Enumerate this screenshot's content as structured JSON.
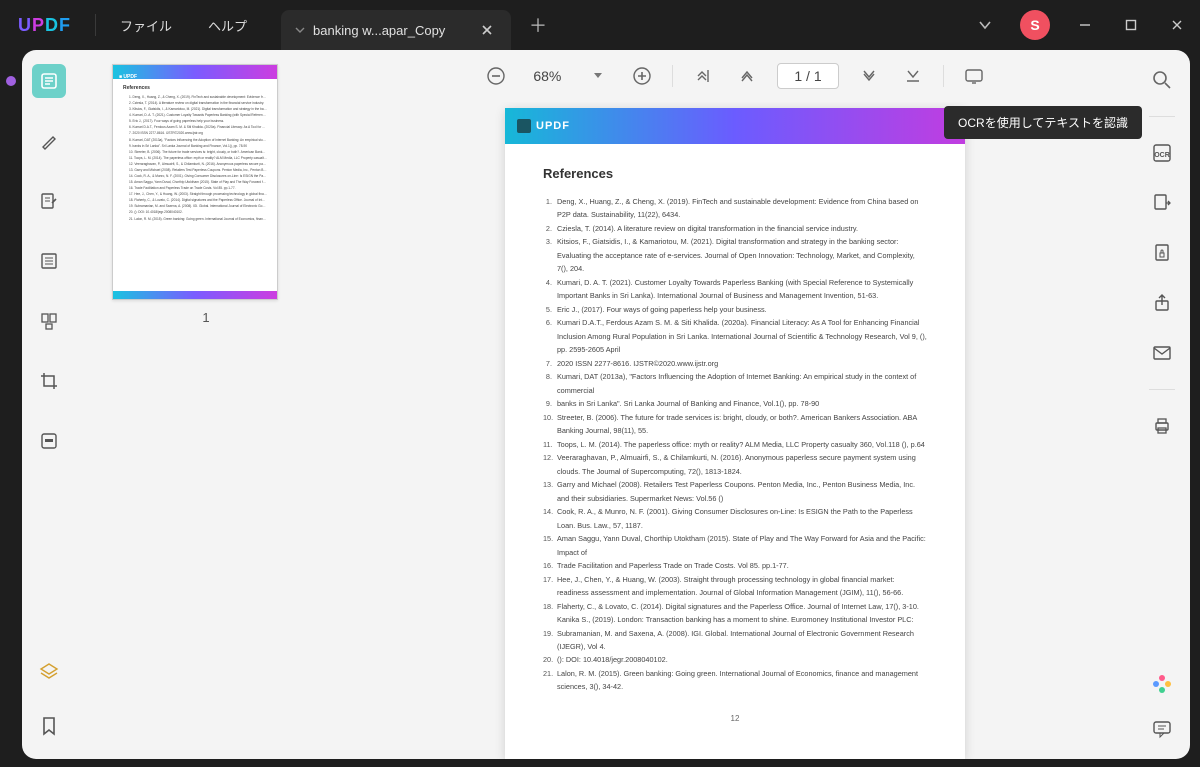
{
  "app": {
    "logo": "UPDF"
  },
  "menu": {
    "file": "ファイル",
    "help": "ヘルプ"
  },
  "tab": {
    "title": "banking w...apar_Copy"
  },
  "user": {
    "initial": "S"
  },
  "toolbar": {
    "zoom": "68%",
    "page_current": "1",
    "page_sep": " / ",
    "page_total": "1"
  },
  "thumb": {
    "number": "1",
    "title": "References"
  },
  "tooltip": {
    "ocr": "OCRを使用してテキストを認識"
  },
  "doc": {
    "brand": "UPDF",
    "title": "References",
    "page_number": "12",
    "refs": [
      "Deng, X., Huang, Z., & Cheng, X. (2019). FinTech and sustainable development: Evidence from China based on P2P data. Sustainability, 11(22), 6434.",
      "Cziesla, T. (2014). A literature review on digital transformation in the financial service industry.",
      "Kitsios, F., Giatsidis, I., & Kamariotou, M. (2021). Digital transformation and strategy in the banking sector: Evaluating the acceptance rate of e-services. Journal of Open Innovation: Technology, Market, and Complexity, 7(), 204.",
      "Kumari, D. A. T. (2021). Customer Loyalty Towards Paperless Banking (with Special Reference to Systemically Important Banks in Sri Lanka). International Journal of Business and Management Invention, 51-63.",
      "Eric J., (2017). Four ways of going paperless help your business.",
      "Kumari D.A.T., Ferdous Azam S. M. & Siti Khalida. (2020a). Financial Literacy: As A Tool for Enhancing Financial Inclusion Among Rural Population in Sri Lanka. International Journal of Scientific & Technology Research, Vol 9, (), pp. 2595-2605 April",
      "2020 ISSN 2277-8616. IJSTR©2020.www.ijstr.org",
      "Kumari, DAT (2013a), \"Factors Influencing the Adoption of Internet Banking: An empirical study in the context of commercial",
      "banks in Sri Lanka\". Sri Lanka Journal of Banking and Finance, Vol.1(), pp. 78-90",
      "Streeter, B. (2006). The future for trade services is: bright, cloudy, or both?. American Bankers Association. ABA Banking Journal, 98(11), 55.",
      "Toops, L. M. (2014). The paperless office: myth or reality? ALM Media, LLC Property casualty 360, Vol.118 (), p.64",
      "Veeraraghavan, P., Almuairfi, S., & Chilamkurti, N. (2016). Anonymous paperless secure payment system using clouds. The Journal of Supercomputing, 72(), 1813-1824.",
      "Garry and Michael (2008). Retailers Test Paperless Coupons. Penton Media, Inc., Penton Business Media, Inc. and their subsidiaries. Supermarket News: Vol.56 ()",
      "Cook, R. A., & Munro, N. F. (2001). Giving Consumer Disclosures on-Line: Is ESIGN the Path to the Paperless Loan. Bus. Law., 57, 1187.",
      "Aman Saggu, Yann Duval, Chorthip Utoktham (2015). State of Play and The Way Forward for Asia and the Pacific: Impact of",
      "Trade Facilitation and Paperless Trade on Trade Costs. Vol 85. pp.1-77.",
      "Hee, J., Chen, Y., & Huang, W. (2003). Straight through processing technology in global financial market: readiness assessment and implementation. Journal of Global Information Management (JGIM), 11(), 56-66.",
      "Flaherty, C., & Lovato, C. (2014). Digital signatures and the Paperless Office. Journal of Internet Law, 17(), 3-10. Kanika S., (2019). London: Transaction banking has a moment to shine. Euromoney Institutional Investor PLC:",
      "Subramanian, M. and Saxena, A. (2008). IGI. Global. International Journal of Electronic Government Research (IJEGR), Vol 4.",
      "(): DOI: 10.4018/jegr.2008040102.",
      "Lalon, R. M. (2015). Green banking: Going green. International Journal of Economics, finance and management sciences, 3(), 34-42."
    ]
  }
}
